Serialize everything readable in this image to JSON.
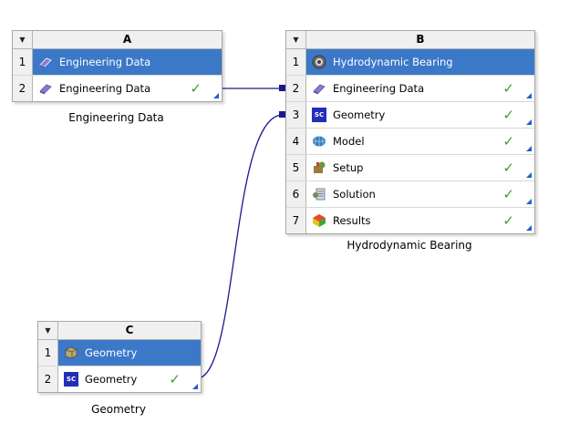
{
  "systems": {
    "a": {
      "letter": "A",
      "caption": "Engineering Data",
      "rows": [
        {
          "num": "1",
          "label": "Engineering Data"
        },
        {
          "num": "2",
          "label": "Engineering Data",
          "status": "✓"
        }
      ]
    },
    "b": {
      "letter": "B",
      "caption": "Hydrodynamic Bearing",
      "rows": [
        {
          "num": "1",
          "label": "Hydrodynamic Bearing"
        },
        {
          "num": "2",
          "label": "Engineering Data",
          "status": "✓"
        },
        {
          "num": "3",
          "label": "Geometry",
          "status": "✓"
        },
        {
          "num": "4",
          "label": "Model",
          "status": "✓"
        },
        {
          "num": "5",
          "label": "Setup",
          "status": "✓"
        },
        {
          "num": "6",
          "label": "Solution",
          "status": "✓"
        },
        {
          "num": "7",
          "label": "Results",
          "status": "✓"
        }
      ]
    },
    "c": {
      "letter": "C",
      "caption": "Geometry",
      "rows": [
        {
          "num": "1",
          "label": "Geometry"
        },
        {
          "num": "2",
          "label": "Geometry",
          "status": "✓"
        }
      ]
    }
  },
  "icons": {
    "collapse": "▼",
    "sc_text": "SC"
  },
  "colors": {
    "header_row": "#3c78c8",
    "link": "#1a1a8c",
    "check": "#4a9a2e",
    "corner": "#1f5fd1"
  }
}
